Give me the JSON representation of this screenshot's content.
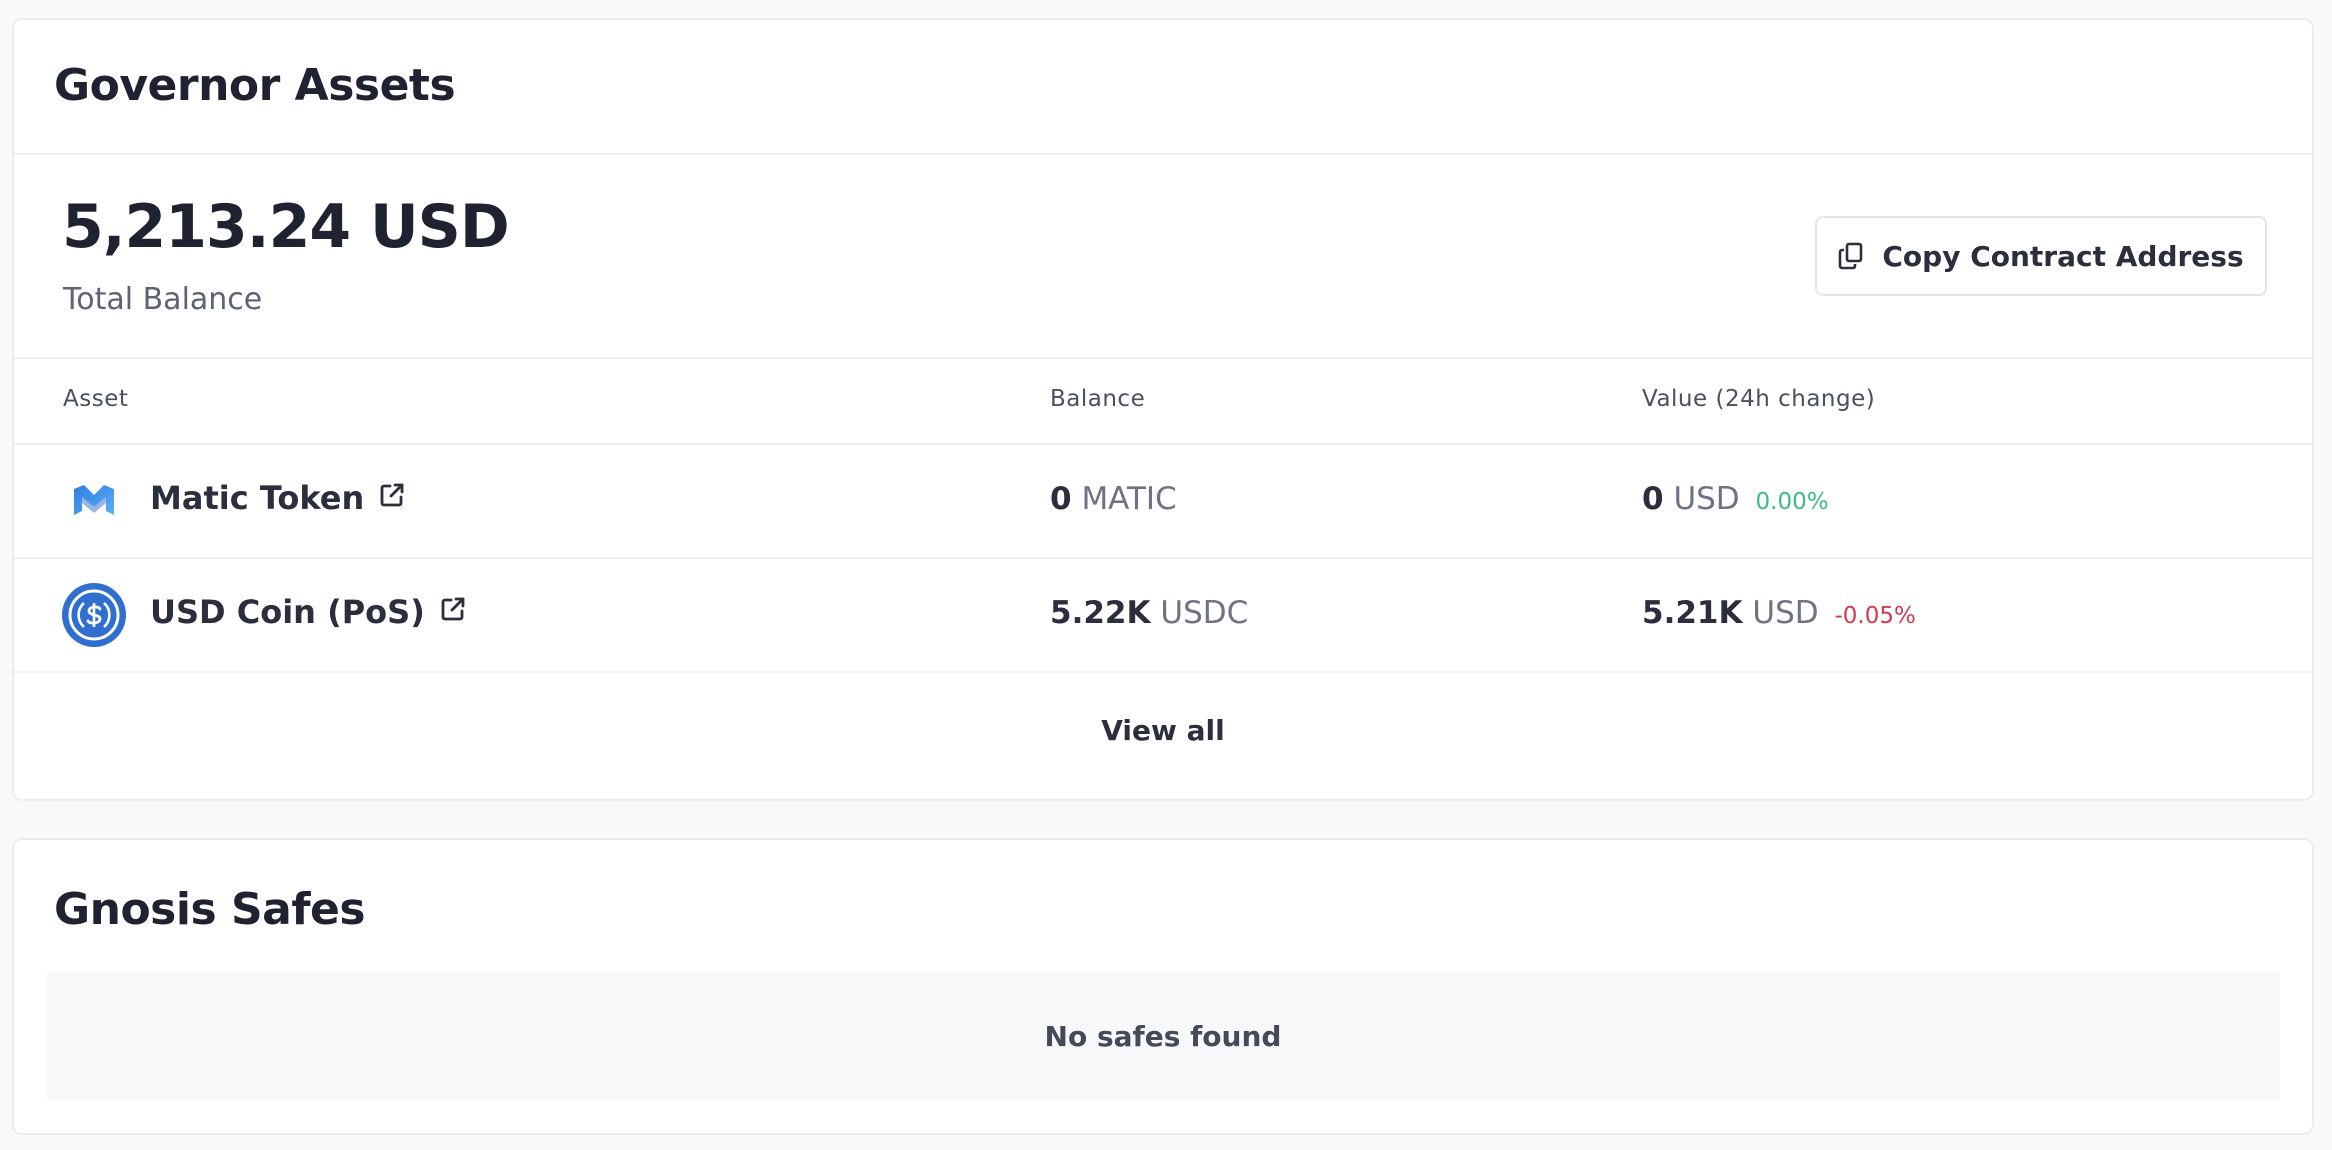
{
  "assets": {
    "title": "Governor Assets",
    "total_balance": "5,213.24 USD",
    "total_balance_label": "Total Balance",
    "copy_button_label": "Copy Contract Address",
    "columns": [
      "Asset",
      "Balance",
      "Value (24h change)"
    ],
    "rows": [
      {
        "name": "Matic Token",
        "icon": "polygon-matic-icon",
        "balance": "0",
        "balance_unit": "MATIC",
        "value": "0",
        "value_unit": "USD",
        "change": "0.00%",
        "change_color": "#3dbb86"
      },
      {
        "name": "USD Coin (PoS)",
        "icon": "usdc-icon",
        "balance": "5.22K",
        "balance_unit": "USDC",
        "value": "5.21K",
        "value_unit": "USD",
        "change": "-0.05%",
        "change_color": "#d23a4e"
      }
    ],
    "view_all_label": "View all"
  },
  "safes": {
    "title": "Gnosis Safes",
    "empty_message": "No safes found"
  }
}
